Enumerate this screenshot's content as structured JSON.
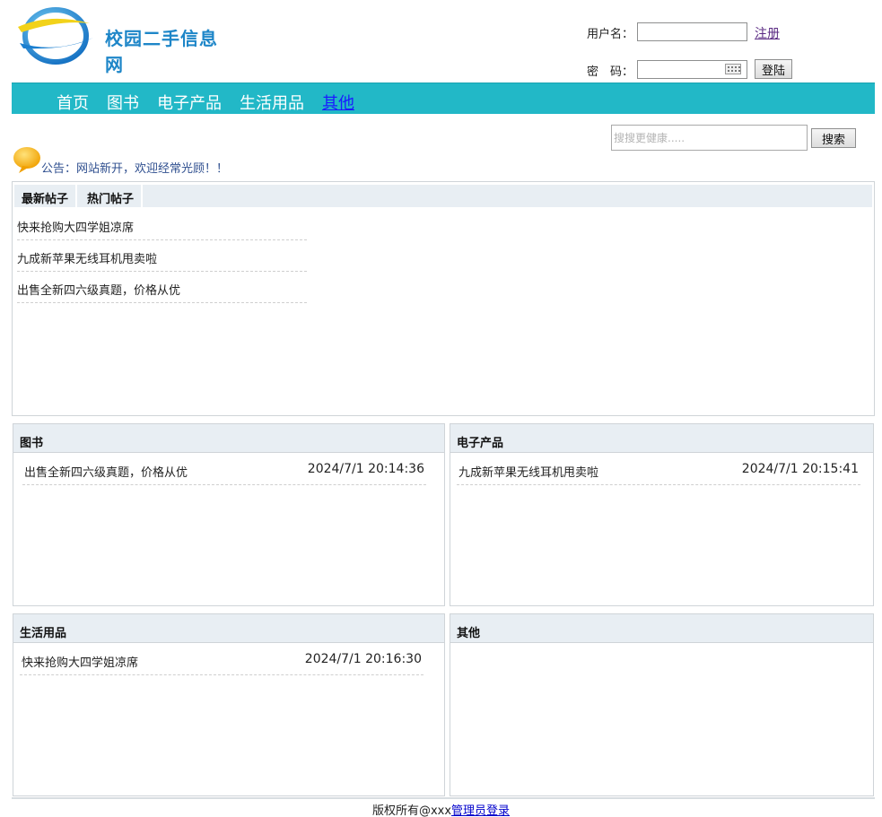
{
  "site": {
    "logo_text": "校园二手信息网"
  },
  "login": {
    "username_label": "用户名：",
    "password_label": "密　码：",
    "register_link": "注册",
    "login_button": "登陆",
    "username_value": "",
    "password_value": ""
  },
  "nav": {
    "items": [
      {
        "label": "首页"
      },
      {
        "label": "图书"
      },
      {
        "label": "电子产品"
      },
      {
        "label": "生活用品"
      },
      {
        "label": "其他"
      }
    ],
    "active_index": 4
  },
  "search": {
    "placeholder": "搜搜更健康.....",
    "button": "搜索"
  },
  "notice": {
    "text": "公告：网站新开，欢迎经常光顾！！"
  },
  "posts": {
    "tabs": [
      "最新帖子",
      "热门帖子"
    ],
    "items": [
      "快来抢购大四学姐凉席",
      "九成新苹果无线耳机甩卖啦",
      "出售全新四六级真题，价格从优"
    ]
  },
  "categories": [
    {
      "title": "图书",
      "items": [
        {
          "title": "出售全新四六级真题，价格从优",
          "date": "2024/7/1 20:14:36"
        }
      ]
    },
    {
      "title": "电子产品",
      "items": [
        {
          "title": "九成新苹果无线耳机甩卖啦",
          "date": "2024/7/1 20:15:41"
        }
      ]
    },
    {
      "title": "生活用品",
      "items": [
        {
          "title": "快来抢购大四学姐凉席",
          "date": "2024/7/1 20:16:30"
        }
      ]
    },
    {
      "title": "其他",
      "items": []
    }
  ],
  "footer": {
    "copyright": "版权所有@xxx",
    "admin_link": "管理员登录"
  },
  "colors": {
    "nav_bg": "#22b8c7",
    "nav_active": "#1a1aff",
    "logo_text": "#1e86c8",
    "panel_header_bg": "#e8eef3"
  }
}
